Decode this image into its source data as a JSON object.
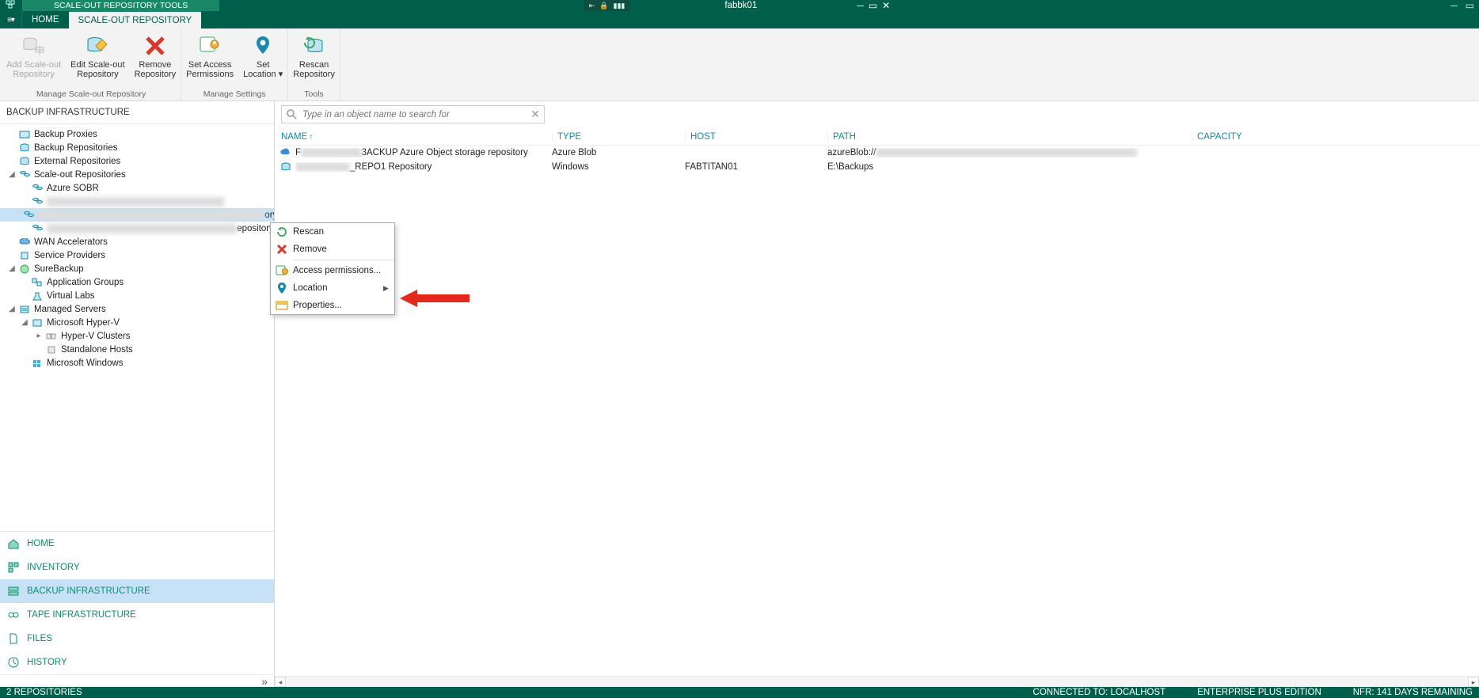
{
  "title_bar": {
    "tools_label": "SCALE-OUT REPOSITORY TOOLS",
    "window_title": "fabbk01"
  },
  "tabs": {
    "home": "HOME",
    "context": "SCALE-OUT REPOSITORY"
  },
  "ribbon": {
    "groups": {
      "manage": "Manage  Scale-out Repository",
      "settings": "Manage Settings",
      "tools": "Tools"
    },
    "add": {
      "l1": "Add Scale-out",
      "l2": "Repository"
    },
    "edit": {
      "l1": "Edit Scale-out",
      "l2": "Repository"
    },
    "remove": {
      "l1": "Remove",
      "l2": "Repository"
    },
    "access": {
      "l1": "Set Access",
      "l2": "Permissions"
    },
    "location": {
      "l1": "Set",
      "l2": "Location ▾"
    },
    "rescan": {
      "l1": "Rescan",
      "l2": "Repository"
    }
  },
  "nav": {
    "title": "BACKUP INFRASTRUCTURE",
    "items": {
      "backup_proxies": "Backup Proxies",
      "backup_repos": "Backup Repositories",
      "external_repos": "External Repositories",
      "scale_out": "Scale-out Repositories",
      "azure_sobr": "Azure SOBR",
      "sor2_suffix": "ory",
      "sor3_suffix": "epository",
      "wan": "WAN Accelerators",
      "svc": "Service Providers",
      "sure": "SureBackup",
      "appgrp": "Application Groups",
      "vlabs": "Virtual Labs",
      "managed": "Managed Servers",
      "hyperv": "Microsoft Hyper-V",
      "clusters": "Hyper-V Clusters",
      "standalone": "Standalone Hosts",
      "mswin": "Microsoft Windows"
    },
    "sections": {
      "home": "HOME",
      "inventory": "INVENTORY",
      "backup_infra": "BACKUP INFRASTRUCTURE",
      "tape_infra": "TAPE INFRASTRUCTURE",
      "files": "FILES",
      "history": "HISTORY"
    }
  },
  "search": {
    "placeholder": "Type in an object name to search for"
  },
  "grid": {
    "headers": {
      "name": "NAME",
      "type": "TYPE",
      "host": "HOST",
      "path": "PATH",
      "capacity": "CAPACITY"
    },
    "rows": [
      {
        "name_prefix": "F",
        "name_suffix": "3ACKUP Azure Object storage repository",
        "type": "Azure Blob",
        "host": "",
        "path_prefix": "azureBlob://"
      },
      {
        "name_suffix": "_REPO1 Repository",
        "type": "Windows",
        "host": "FABTITAN01",
        "path": "E:\\Backups"
      }
    ]
  },
  "context_menu": {
    "rescan": "Rescan",
    "remove": "Remove",
    "access": "Access permissions...",
    "location": "Location",
    "properties": "Properties..."
  },
  "status": {
    "left": "2 REPOSITORIES",
    "connected": "CONNECTED TO: LOCALHOST",
    "edition": "ENTERPRISE PLUS EDITION",
    "nfr": "NFR: 141 DAYS REMAINING"
  }
}
